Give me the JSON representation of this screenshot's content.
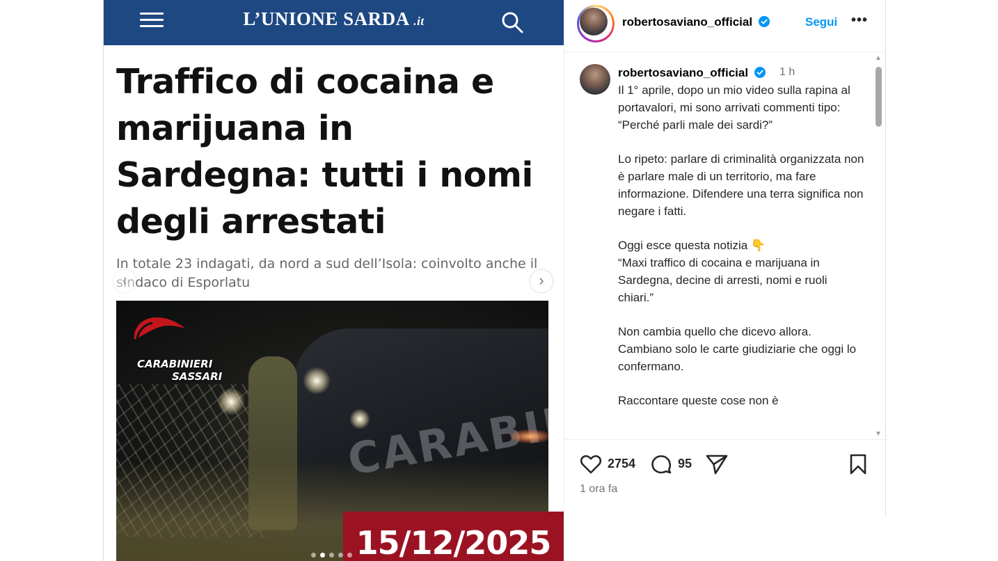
{
  "news": {
    "logo_main": "L’UNIONE SARDA",
    "logo_tld": ".it",
    "headline": "Traffico di cocaina e marijuana in Sardegna: tutti i nomi degli arrestati",
    "subhead": "In totale 23 indagati, da nord a sud dell’Isola: coinvolto anche il sindaco di Esporlatu",
    "photo_badge_line1": "CARABINIERI",
    "photo_badge_line2": "SASSARI",
    "photo_car_text": "CARABINIERI",
    "date_banner": "15/12/2025",
    "carousel_prev": "‹",
    "carousel_next": "›",
    "slide_count": 5,
    "active_slide": 2
  },
  "post": {
    "username": "robertosaviano_official",
    "follow_label": "Segui",
    "more_label": "•••",
    "comment_time": "1 h",
    "caption": "Il 1° aprile, dopo un mio video sulla rapina al portavalori, mi sono arrivati commenti tipo: “Perché parli male dei sardi?”\n\nLo ripeto: parlare di criminalità organizzata non è parlare male di un territorio, ma fare informazione. Difendere una terra significa non negare i fatti.\n\nOggi esce questa notizia 👇\n“Maxi traffico di cocaina e marijuana in Sardegna, decine di arresti, nomi e ruoli chiari.”\n\nNon cambia quello che dicevo allora. Cambiano solo le carte giudiziarie che oggi lo confermano.\n\nRaccontare queste cose non è",
    "likes": "2754",
    "comments": "95",
    "posted_ago": "1 ora fa"
  },
  "icons": {
    "menu": "hamburger-icon",
    "search": "search-icon",
    "verified": "verified-badge-icon",
    "like": "heart-icon",
    "comment": "comment-icon",
    "share": "send-icon",
    "save": "bookmark-icon"
  },
  "colors": {
    "news_header": "#1d4882",
    "date_banner": "#9b1322",
    "follow_blue": "#0095f6",
    "verified_blue": "#0095f6"
  }
}
